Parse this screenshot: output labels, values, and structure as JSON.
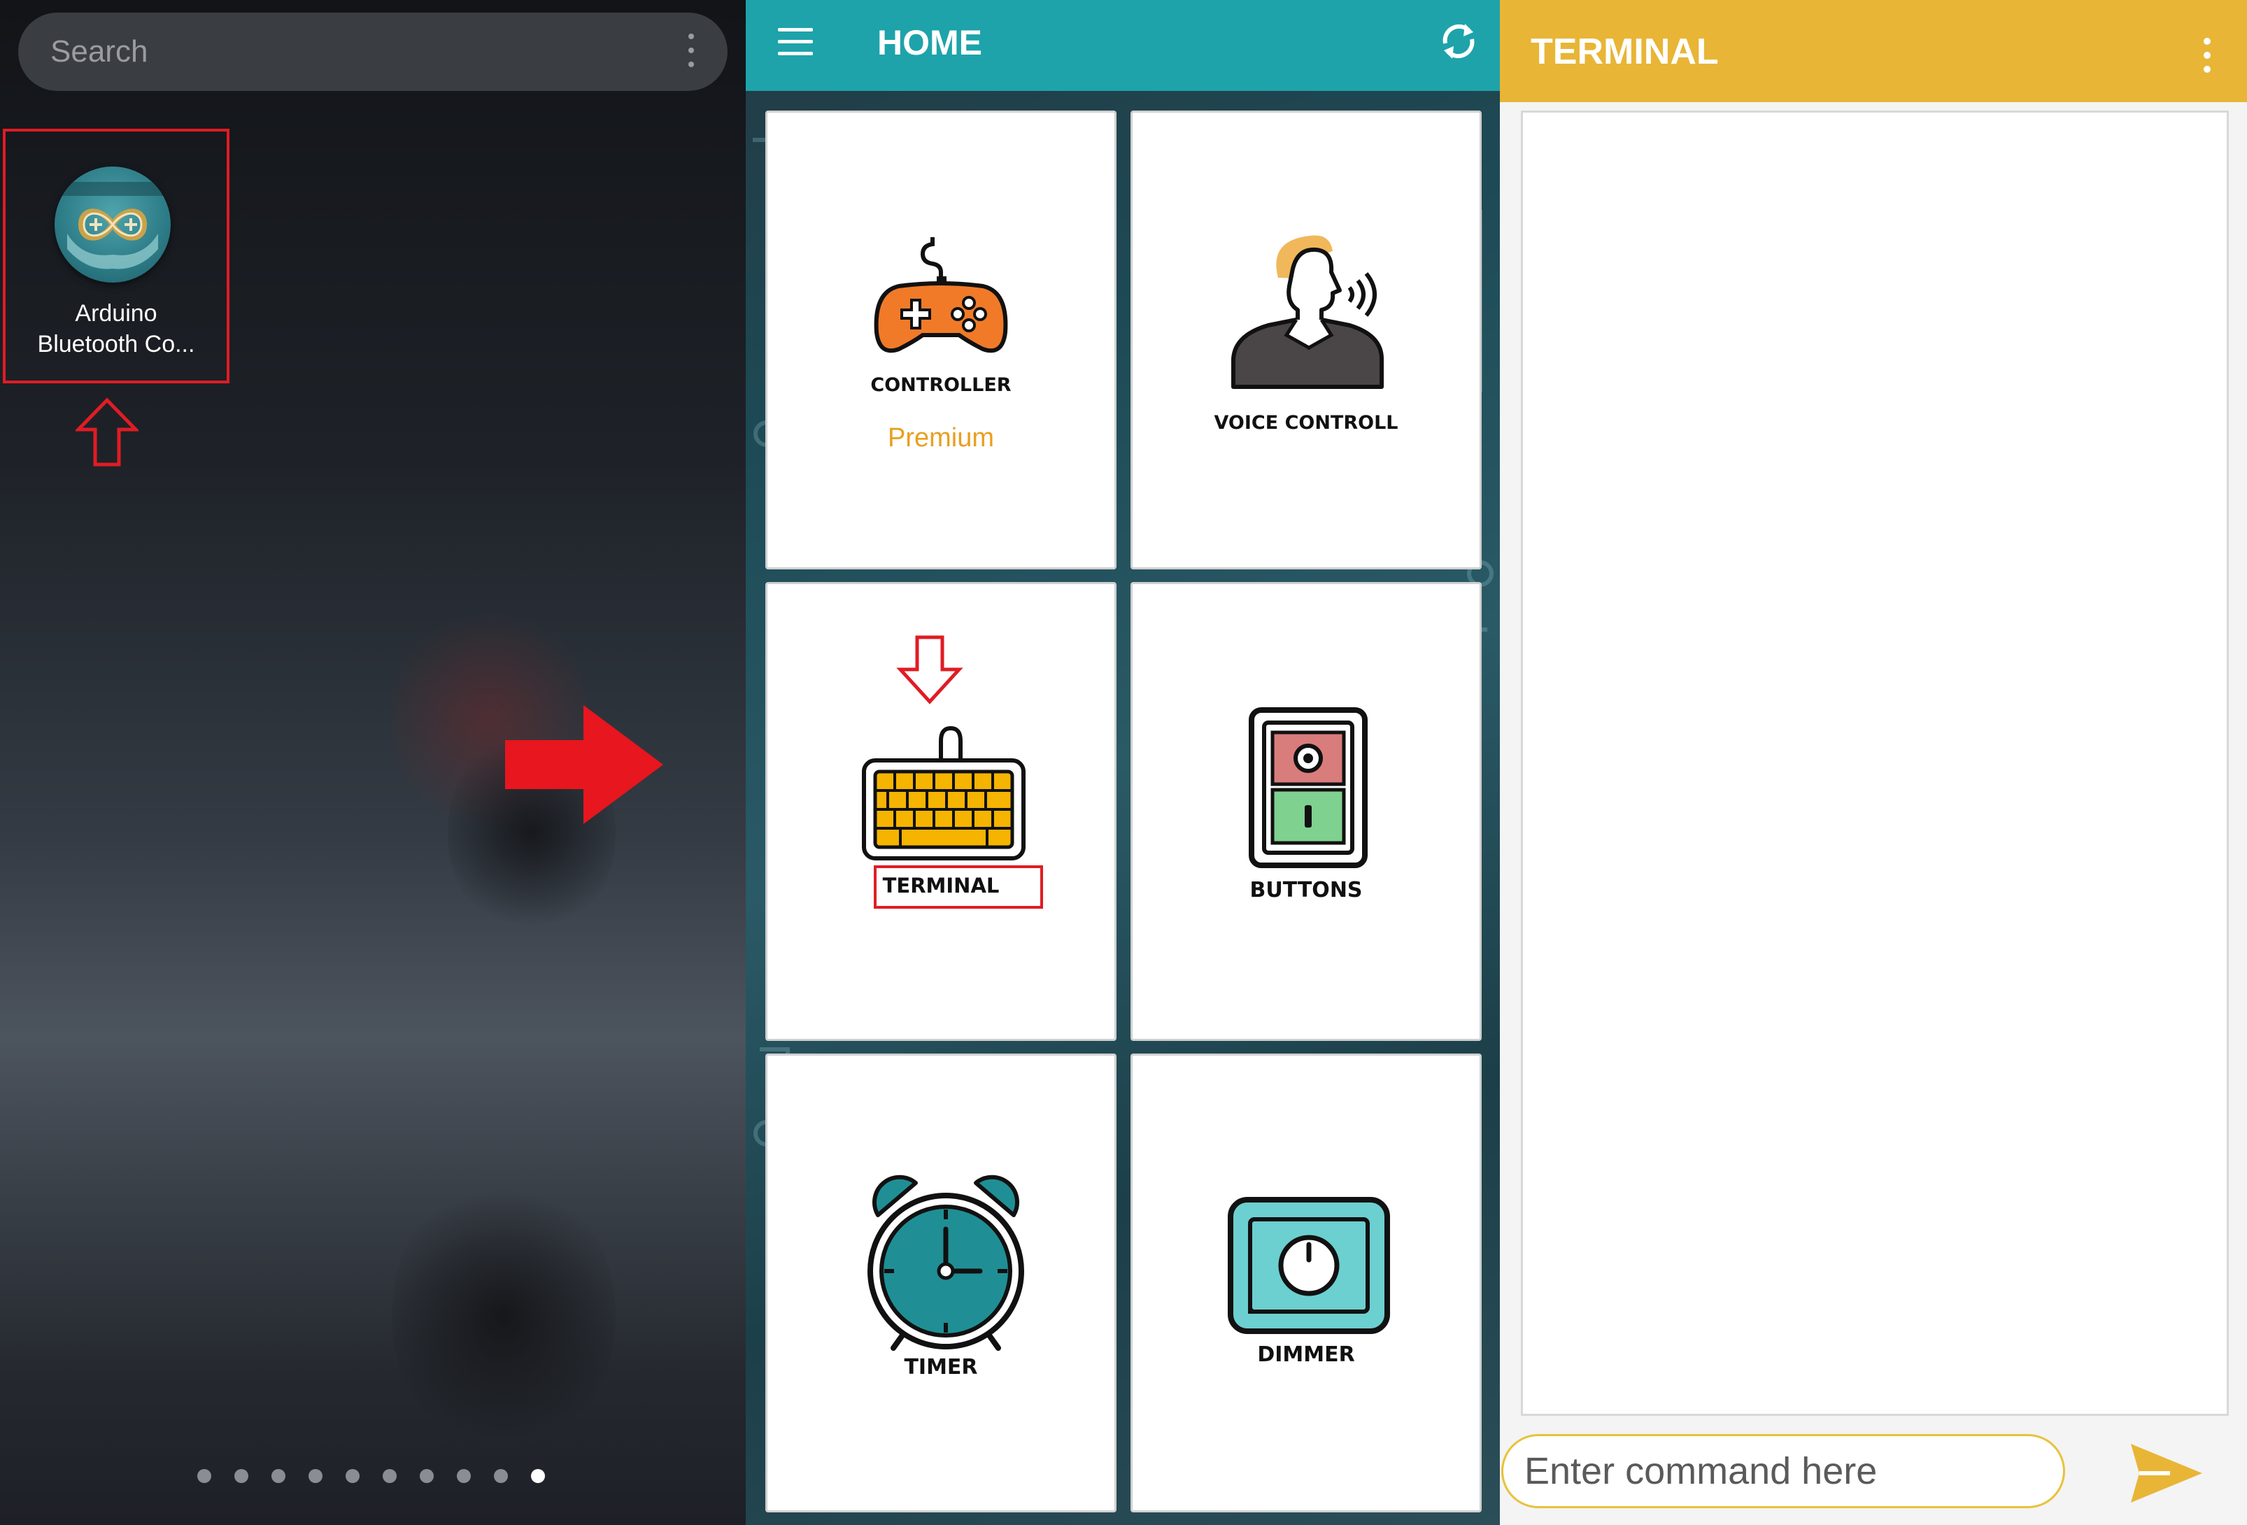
{
  "launcher": {
    "search_placeholder": "Search",
    "app": {
      "name_line1": "Arduino",
      "name_line2": "Bluetooth Co..."
    },
    "page_dots": {
      "count": 10,
      "active_index": 9
    }
  },
  "home": {
    "title": "HOME",
    "cards": {
      "controller": {
        "label": "CONTROLLER",
        "badge": "Premium"
      },
      "voice": {
        "label": "VOICE CONTROLL"
      },
      "terminal": {
        "label": "TERMINAL"
      },
      "buttons": {
        "label": "BUTTONS"
      },
      "timer": {
        "label": "TIMER"
      },
      "dimmer": {
        "label": "DIMMER"
      }
    }
  },
  "terminal": {
    "title": "TERMINAL",
    "input_placeholder": "Enter command here"
  },
  "colors": {
    "annotation_red": "#e01c24",
    "home_bar": "#1ea3aa",
    "terminal_bar": "#e8b536",
    "premium": "#e8a020"
  },
  "icons": [
    "search-menu-icon",
    "app-icon",
    "up-arrow-icon",
    "right-arrow-icon",
    "hamburger-icon",
    "refresh-icon",
    "gamepad-icon",
    "person-speaking-icon",
    "down-arrow-icon",
    "keyboard-icon",
    "switch-icon",
    "alarm-clock-icon",
    "dimmer-icon",
    "overflow-menu-icon",
    "send-icon"
  ]
}
